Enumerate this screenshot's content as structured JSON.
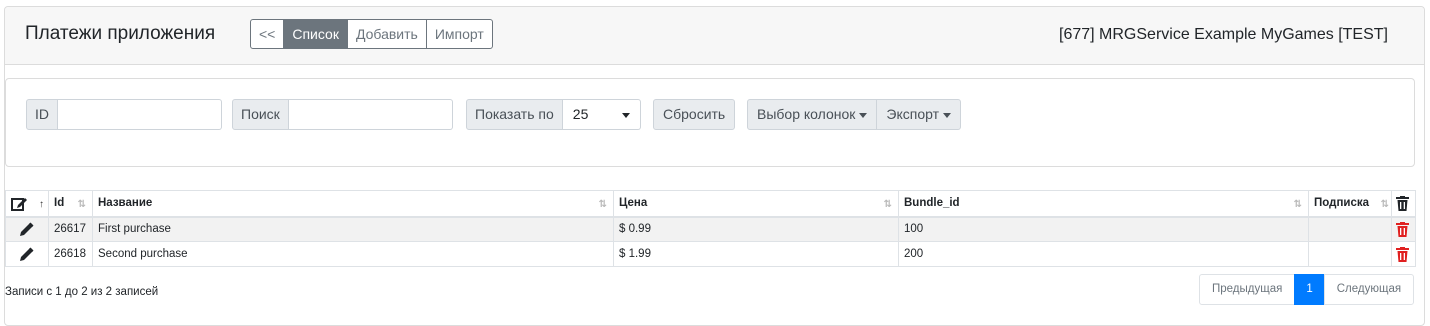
{
  "header": {
    "title": "Платежи приложения",
    "nav": {
      "back": "<<",
      "list": "Список",
      "add": "Добавить",
      "import": "Импорт"
    },
    "app_name": "[677] MRGService Example MyGames [TEST]"
  },
  "filters": {
    "id_label": "ID",
    "id_value": "",
    "search_label": "Поиск",
    "search_value": "",
    "page_size_label": "Показать по",
    "page_size_value": "25",
    "reset_label": "Сбросить",
    "columns_label": "Выбор колонок",
    "export_label": "Экспорт"
  },
  "table": {
    "columns": [
      "Id",
      "Название",
      "Цена",
      "Bundle_id",
      "Подписка"
    ],
    "rows": [
      {
        "id": "26617",
        "name": "First purchase",
        "price": "$ 0.99",
        "bundle_id": "100",
        "subscription": ""
      },
      {
        "id": "26618",
        "name": "Second purchase",
        "price": "$ 1.99",
        "bundle_id": "200",
        "subscription": ""
      }
    ]
  },
  "footer": {
    "info": "Записи с 1 до 2 из 2 записей",
    "prev": "Предыдущая",
    "current_page": "1",
    "next": "Следующая"
  },
  "colors": {
    "accent": "#007bff",
    "delete": "#e02020",
    "secondary": "#6c757d"
  },
  "icons": {
    "edit_column": "edit-square-icon",
    "row_edit": "pencil-icon",
    "row_delete": "trash-icon",
    "header_delete": "trash-icon"
  }
}
